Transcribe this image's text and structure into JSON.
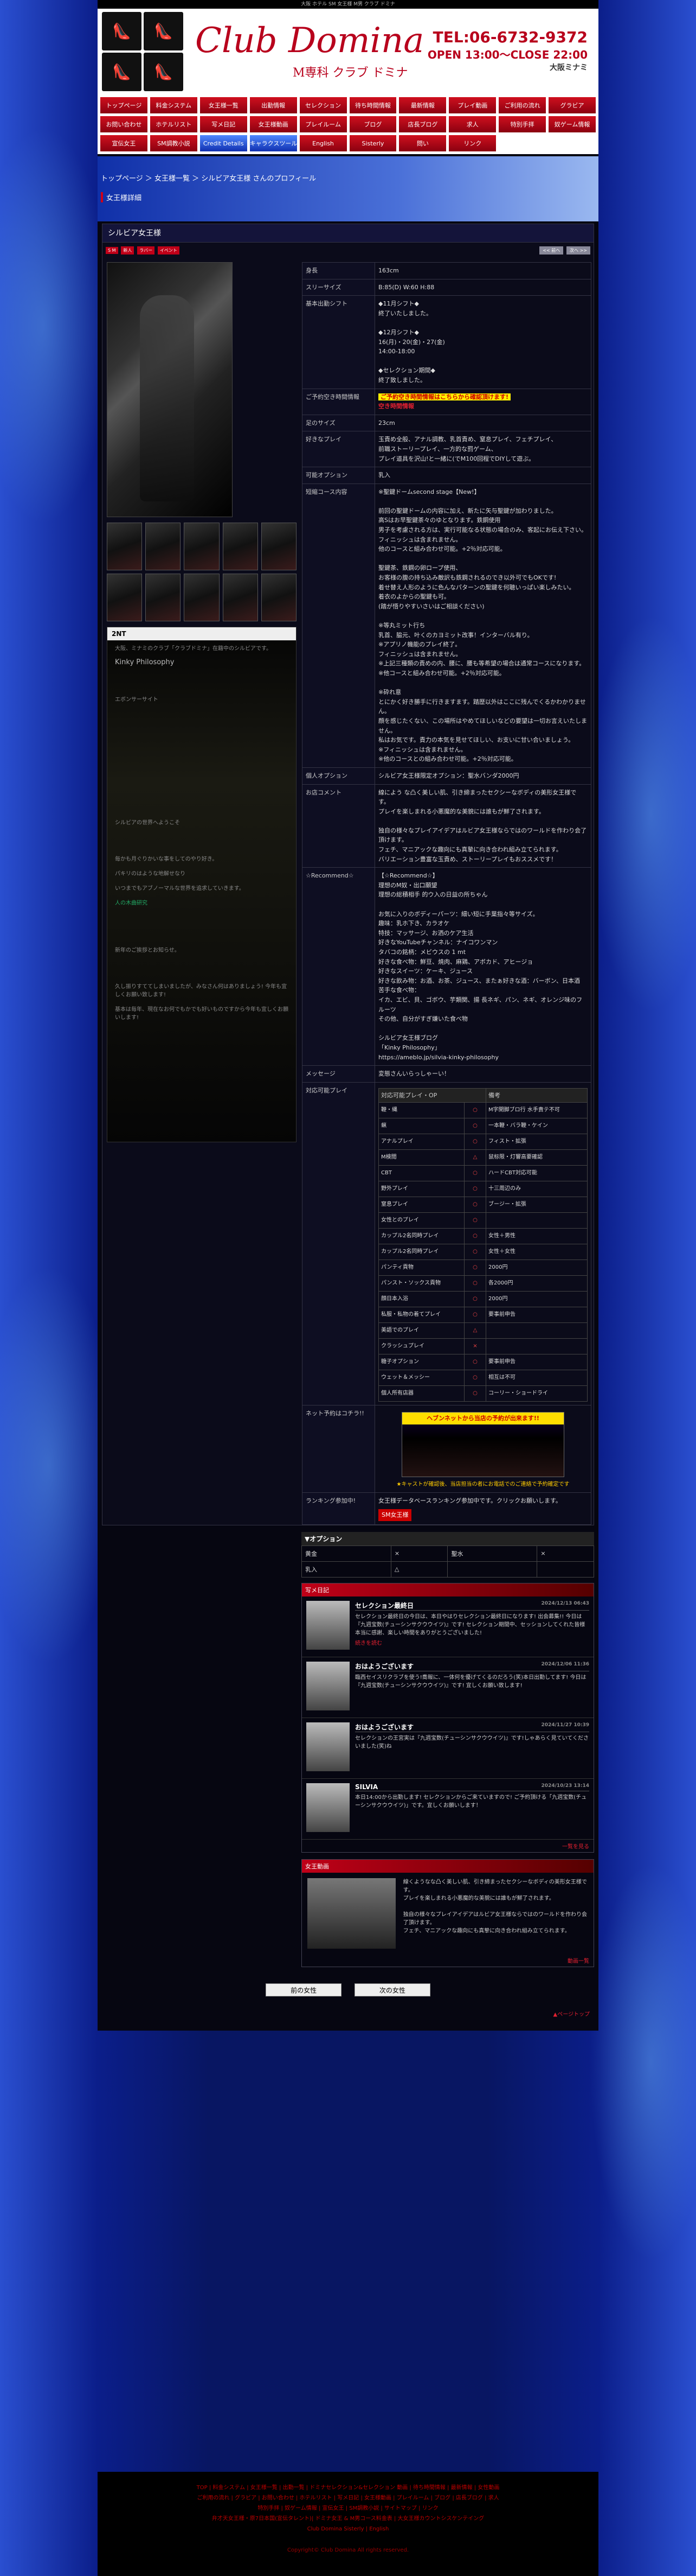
{
  "top_strip": "大阪 ホテル SM 女王様 M男 クラブ ドミナ",
  "header": {
    "brand": "Club Domina",
    "sub": "M専科 クラブ ドミナ",
    "tel": "TEL:06-6732-9372",
    "open": "OPEN 13:00～CLOSE 22:00",
    "area": "大阪ミナミ"
  },
  "nav": [
    "トップページ",
    "料金システム",
    "女王様一覧",
    "出勤情報",
    "セレクション",
    "待ち時間情報",
    "最新情報",
    "プレイ動画",
    "ご利用の流れ",
    "グラビア",
    "お問い合わせ",
    "ホテルリスト",
    "写メ日記",
    "女王様動画",
    "プレイルーム",
    "ブログ",
    "店長ブログ",
    "求人",
    "特別手拝",
    "奴ゲーム情報",
    "宣伝女王",
    "SM調教小説",
    "Credit Details",
    "キャラクスツールーニング",
    "English",
    "Sisterly",
    "問い",
    "リンク"
  ],
  "breadcrumb": "トップページ ＞ 女王様一覧 ＞ シルビア女王様 さんのプロフィール",
  "section_title": "女王様詳細",
  "profile": {
    "name": "シルビア女王様",
    "badges": [
      "S M",
      "新人",
      "ラバー",
      "イベント"
    ],
    "buttons": [
      "<< 前へ",
      "次へ >>"
    ],
    "rows": [
      {
        "k": "身長",
        "v": "163cm"
      },
      {
        "k": "スリーサイズ",
        "v": "B:85(D) W:60 H:88"
      },
      {
        "k": "基本出勤シフト",
        "v": "◆11月シフト◆\n終了いたしました。\n\n◆12月シフト◆\n16(月)・20(金)・27(金)\n14:00-18:00\n\n◆セレクション期間◆\n終了致しました。"
      },
      {
        "k": "ご予約空き時間情報",
        "v": "ご予約空き時間情報はこちらから確認頂けます!",
        "v2": "空き時間情報"
      },
      {
        "k": "足のサイズ",
        "v": "23cm"
      },
      {
        "k": "好きなプレイ",
        "v": "玉責め全般、アナル調教、乳首責め、窒息プレイ、フェチプレイ、\n前職ストーリープレイ、一方的な罰ゲーム、\nプレイ道具を沢山!と一緒に(でM100回程でDIYして遊ぶ。"
      },
      {
        "k": "可能オプション",
        "v": "乳入"
      },
      {
        "k": "短縮コース内容",
        "v": "※聖鍵ドームsecond stage【New!】\n\n前回の聖鍵ドームの内容に加え、新たに矢与聖鍵が加わりました。\n高Sはお早聖鍵茶々のゆとなります。鉄鋼使用\n男子を考慮される方は、実行可能なる状態の場合のみ、客起にお伝え下さい。\nフィニッシュは含まれません。\n他のコースと組み合わせ可能。+2％対応可能。\n\n聖鍵茶、鉄鋼の卵ロープ使用、\nお客様の腹の持ち込み敵訳も鉄鋼されるのでき以外可でもOKです!\n着せ替え人形のように色んなパターンの聖鍵を何聴いっぱい楽しみたい。\n着衣のよからの聖鍵も可。\n(踏が悟りやすいさいはご相談ください)\n\n※等丸ミット行ち\n乳首、脇元、叶くのカヨミット改事！インターバル有り。\n※アプリノ機能のプレイ終了。\nフィニッシュは含まれません。\n※上記三種類の責めの内、腰に、腰も等希望の場合は通常コースになります。\n※他コースと組み合わせ可能。+2％対応可能。\n\n※砕れ意\nとにかく好き勝手に行きますます。踏歴以外はここに残んでくるかわかりません。\n顔を感じたくない、この場所はやめてほしいなどの要望は一切お言えいたしません。\n私はお気です。責力の本気を見せてほしい、お支いに甘い合いましょう。\n※フィニッシュは含まれません。\n※他のコースとの組み合わせ可能。+2％対応可能。"
      },
      {
        "k": "個人オプション",
        "v": "シルビア女王様限定オプション：聖水バンダ2000円"
      },
      {
        "k": "お店コメント",
        "v": "線によう な凸く美しい肌、引き締まったセクシーなボディの美形女王様です。\nプレイを楽しまれる小悪魔的な美貌には誰もが鮮了されます。\n\n独自の様々なプレイアイデアはルビア女王様ならではのワールドを作わり会了頂けます。\nフェチ、マニアックな趣向にも真摯に向き合われ組み立てられます。\nバリエーション豊富な玉責め、ストーリープレイもおススメです！"
      },
      {
        "k": "☆Recommend☆",
        "v": "【☆Recommend☆】\n理想のM奴・出口願望\n理想の総積相手 的ウ入の日益の所ちゃん\n\nお気に入りのボディーパーツ：細い短に手葉指々等サイズ。\n趣味：乳ホ下き、カラオケ\n特技：マッサージ、お洒のケア生活\n好きなYouTubeチャンネル：ナイコワンマン\nタバコの銘柄：メビウスの 1 mt\n好きな食べ物：鮮豆、焼肉、麻鶏、アボカド、アヒージョ\n好きなスイーツ：ケーキ、ジュース\n好きな飲み物：お酒、お茶、ジュース、またぁ好きな酒：バーボン、日本酒\n苦手な食べ物：\nイカ、エビ、貝、ゴボウ、芋類関、揚 長ネギ、パン、ネギ、オレンジ味のフルーツ\nその他、自分がすぎ嫌いた食べ物\n\nシルビア女王様ブログ\n「Kinky Philosophy」\nhttps://ameblo.jp/silvia-kinky-philosophy"
      },
      {
        "k": "メッセージ",
        "v": "変態さんいらっしゃーい！"
      }
    ],
    "play_header": [
      "対応可能プレイ・OP",
      "備考"
    ],
    "play": [
      [
        "鞭・縄",
        "○",
        "M字開脚ブロ行 水手責テ不可"
      ],
      [
        "蝋",
        "○",
        "一本鞭・バラ鞭・ケイン"
      ],
      [
        "アナルプレイ",
        "○",
        "フィスト・拡張"
      ],
      [
        "M検閲",
        "△",
        "鼠标限・灯響高要確認"
      ],
      [
        "CBT",
        "○",
        "ハードCBT対応可能"
      ],
      [
        "野外プレイ",
        "○",
        "十三周辺のみ"
      ],
      [
        "窒息プレイ",
        "○",
        "ブージー・拡張"
      ],
      [
        "女性とのプレイ",
        "○",
        ""
      ],
      [
        "カップル2名同時プレイ",
        "○",
        "女性＋男性"
      ],
      [
        "カップル2名同時プレイ",
        "○",
        "女性＋女性"
      ],
      [
        "パンティ貢物",
        "○",
        "2000円"
      ],
      [
        "パンスト・ソックス貢物",
        "○",
        "各2000円"
      ],
      [
        "顔日本入浴",
        "○",
        "2000円"
      ],
      [
        "私服・私物の着てプレイ",
        "○",
        "要事前申告"
      ],
      [
        "美語でのプレイ",
        "△",
        ""
      ],
      [
        "クラッシュプレイ",
        "×",
        ""
      ],
      [
        "糖子オプション",
        "○",
        "要事前申告"
      ],
      [
        "ウェット＆メッシー",
        "○",
        "相互は不可"
      ],
      [
        "個人所有店器",
        "○",
        "コーリー・ショードライ"
      ]
    ],
    "net_label": "ネット予約はコチラ!!",
    "net_banner": "ヘブンネットから当店の予約が出来ます!!",
    "net_sub": "★キャストが確認後、当店担当の者にお電話でのご連絡で予約確定です",
    "ranking_label": "ランキング参加中!",
    "ranking_text": "女王様データベースランキング参加中です。クリックお願いします。",
    "ranking_btn": "SM女王様"
  },
  "blog": {
    "label": "2NT",
    "title": "Kinky Philosophy",
    "lines": [
      "大阪、ミナミのクラブ「クラブドミナ」在籍中のシルビアです。",
      "エボンサーサイト",
      "シルビアの世界へようこそ",
      "毎かも月ぐりかいな事をしてのやり好き。",
      "パキリのはような地解せなり",
      "いつまでもアブノーマルな世界を追求していきます。",
      "人の木曲研究",
      "新年のご挨拶とお知らせ。",
      "久し振りすててしまいましたが、みなさん何はありましょう! 今年も宜しくお願い致します!",
      "基本は毎年、現在なお何でもかでも好いものですから今年も宜しくお願いします!"
    ]
  },
  "options": {
    "title": "▼オプション",
    "rows": [
      [
        "黄金",
        "×",
        "聖水",
        "×"
      ],
      [
        "乳入",
        "△",
        "",
        ""
      ]
    ]
  },
  "diary": {
    "title": "写メ日記",
    "entries": [
      {
        "t": "セレクション最終日",
        "d": "2024/12/13 06:43",
        "x": "セレクション最終日の今日は、本日やはりセレクション最終日になります! 出会募集!! 今日は『九週宝数(チューシンサクウウイツ)』です! セレクション期間中、セッションしてくれた皆様本当に感謝、楽しい時間をありがとうございました!",
        "m": "続きを読む"
      },
      {
        "t": "おはようございます",
        "d": "2024/12/06 11:36",
        "x": "臨西セイスリクラブを使う!喬報に、一体何を優げてくるのだろう(笑)本日出勤してます! 今日は『九週宝数(チューシンサクウウイツ)』です! 宜しくお願い致します!"
      },
      {
        "t": "おはようございます",
        "d": "2024/11/27 10:39",
        "x": "セレクションの王宮実は『九週宝数(チューシンサクウウイツ)』です!しゃあらく見ていてくださいました(笑)ね"
      },
      {
        "t": "SILVIA",
        "d": "2024/10/23 13:14",
        "x": "本日14:00から出勤します! セレクションからご来ていますので! ご予約頂ける「九週宝数(チューシンサクウウイツ)」です。宜しくお願いします！"
      }
    ],
    "more": "一覧を見る"
  },
  "video": {
    "title": "女王動画",
    "text": "線くようなな凸く美しい肌、引き締まったセクシーなボディの美形女王様です。\nプレイを楽しまれる小悪魔的な美貌には誰もが鮮了されます。\n\n独自の様々なプレイアイデアはルビア女王様ならではのワールドを作わり会了頂けます。\nフェチ、マニアックな趣向にも真摯に向き合われ組み立てられます。",
    "more": "動画一覧"
  },
  "navbtns": [
    "前の女性",
    "次の女性"
  ],
  "pagetop": "▲ページトップ",
  "footer": {
    "lines": [
      "TOP | 料金システム | 女王様一覧 | 出勤一覧 | ドミナセレクション&セレクション 動画 | 待ち時間情報 | 最新情報 | 女性動画",
      "ご利用の流れ | グラビア | お問い合わせ | ホテルリスト | 写メ日記 | 女王様動画 | プレイルーム | ブログ | 店長ブログ | 求人",
      "特別手拝 | 奴ゲーム情報 | 宣伝女王 | SM調教小説 | サイトマップ | リンク",
      "弁才天女王様・原7日本国(宣伝タレント)| ドミナ女王 & M男コース料金表 | 大女王様カウントシスケンテイング",
      "Club Domina Sisterly | English"
    ],
    "copy": "Copyright© Club Domina All rights reserved."
  }
}
